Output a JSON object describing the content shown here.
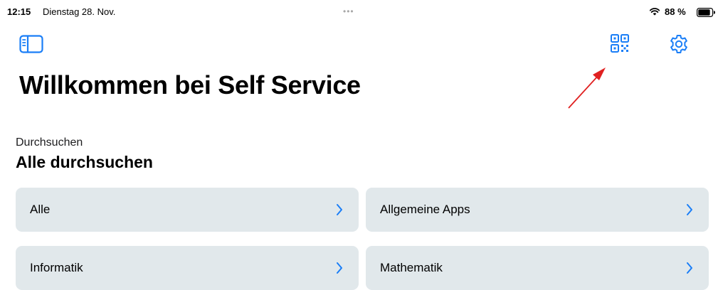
{
  "status_bar": {
    "time": "12:15",
    "date": "Dienstag 28. Nov.",
    "multitask_dots": "•••",
    "battery_percent": "88 %",
    "battery_level": 0.88,
    "wifi_icon": "wifi-icon",
    "battery_icon": "battery-icon"
  },
  "toolbar": {
    "left_icon": "sidebar-toggle-icon",
    "right_icons": [
      "qr-code-icon",
      "gear-icon"
    ]
  },
  "page": {
    "title": "Willkommen bei Self Service"
  },
  "browse_section": {
    "caption": "Durchsuchen",
    "title": "Alle durchsuchen",
    "categories": [
      {
        "label": "Alle"
      },
      {
        "label": "Allgemeine Apps"
      },
      {
        "label": "Informatik"
      },
      {
        "label": "Mathematik"
      }
    ],
    "chevron_icon": "chevron-right-icon"
  },
  "annotation": {
    "type": "red-arrow",
    "color": "#e02020",
    "points_to": "qr-code-button"
  },
  "colors": {
    "accent": "#1a7ef7",
    "card_background": "#e1e8eb",
    "text": "#000000",
    "annotation": "#e02020"
  }
}
